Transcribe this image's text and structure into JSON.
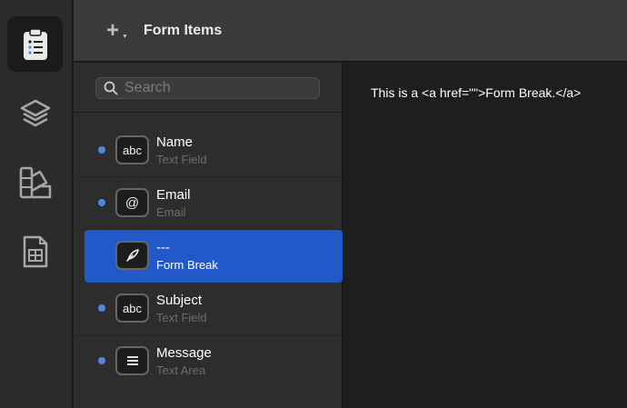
{
  "toolbar": {
    "title": "Form Items",
    "add_icon": "plus-icon"
  },
  "sidebar": {
    "items": [
      {
        "name": "form-clipboard",
        "icon": "clipboard-list-icon",
        "active": true
      },
      {
        "name": "layers",
        "icon": "layers-icon",
        "active": false
      },
      {
        "name": "theme",
        "icon": "swatches-icon",
        "active": false
      },
      {
        "name": "table",
        "icon": "spreadsheet-icon",
        "active": false
      }
    ]
  },
  "search": {
    "placeholder": "Search",
    "value": ""
  },
  "list": {
    "items": [
      {
        "title": "Name",
        "subtitle": "Text Field",
        "icon_label": "abc",
        "icon": "text-field-icon",
        "selected": false
      },
      {
        "title": "Email",
        "subtitle": "Email",
        "icon_label": "@",
        "icon": "at-sign-icon",
        "selected": false
      },
      {
        "title": "---",
        "subtitle": "Form Break",
        "icon_label": "",
        "icon": "quill-icon",
        "selected": true
      },
      {
        "title": "Subject",
        "subtitle": "Text Field",
        "icon_label": "abc",
        "icon": "text-field-icon",
        "selected": false
      },
      {
        "title": "Message",
        "subtitle": "Text Area",
        "icon_label": "",
        "icon": "text-area-icon",
        "selected": false
      }
    ]
  },
  "detail": {
    "text": "This is a <a href=\"\">Form Break.</a>"
  },
  "colors": {
    "selection": "#2358c9",
    "dot": "#4f86e8",
    "toolbar_bg": "#3a3a3a",
    "list_bg": "#2d2d2d",
    "rail_bg": "#2b2b2b",
    "detail_bg": "#1e1e1e"
  }
}
